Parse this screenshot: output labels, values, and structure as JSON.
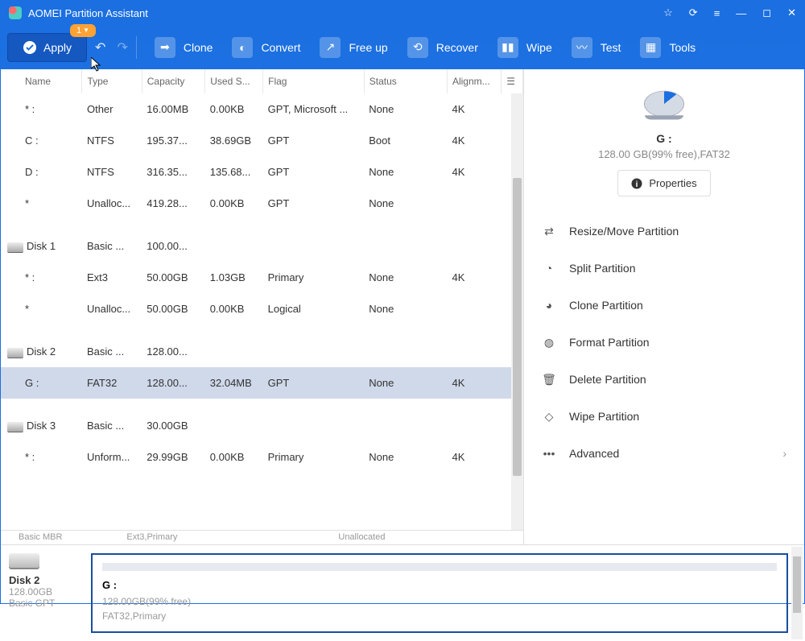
{
  "title": "AOMEI Partition Assistant",
  "apply": {
    "label": "Apply",
    "badge": "1"
  },
  "toolbar": [
    {
      "id": "clone",
      "label": "Clone"
    },
    {
      "id": "convert",
      "label": "Convert"
    },
    {
      "id": "freeup",
      "label": "Free up"
    },
    {
      "id": "recover",
      "label": "Recover"
    },
    {
      "id": "wipe",
      "label": "Wipe"
    },
    {
      "id": "test",
      "label": "Test"
    },
    {
      "id": "tools",
      "label": "Tools"
    }
  ],
  "columns": {
    "name": "Name",
    "type": "Type",
    "capacity": "Capacity",
    "used": "Used S...",
    "flag": "Flag",
    "status": "Status",
    "align": "Alignm..."
  },
  "rows": [
    {
      "disk": false,
      "name": "* :",
      "type": "Other",
      "cap": "16.00MB",
      "used": "0.00KB",
      "flag": "GPT, Microsoft ...",
      "status": "None",
      "align": "4K"
    },
    {
      "disk": false,
      "name": "C :",
      "type": "NTFS",
      "cap": "195.37...",
      "used": "38.69GB",
      "flag": "GPT",
      "status": "Boot",
      "align": "4K"
    },
    {
      "disk": false,
      "name": "D :",
      "type": "NTFS",
      "cap": "316.35...",
      "used": "135.68...",
      "flag": "GPT",
      "status": "None",
      "align": "4K"
    },
    {
      "disk": false,
      "name": "*",
      "type": "Unalloc...",
      "cap": "419.28...",
      "used": "0.00KB",
      "flag": "GPT",
      "status": "None",
      "align": ""
    },
    {
      "disk": true,
      "name": "Disk 1",
      "type": "Basic ...",
      "cap": "100.00...",
      "used": "",
      "flag": "",
      "status": "",
      "align": ""
    },
    {
      "disk": false,
      "name": "* :",
      "type": "Ext3",
      "cap": "50.00GB",
      "used": "1.03GB",
      "flag": "Primary",
      "status": "None",
      "align": "4K"
    },
    {
      "disk": false,
      "name": "*",
      "type": "Unalloc...",
      "cap": "50.00GB",
      "used": "0.00KB",
      "flag": "Logical",
      "status": "None",
      "align": ""
    },
    {
      "disk": true,
      "name": "Disk 2",
      "type": "Basic ...",
      "cap": "128.00...",
      "used": "",
      "flag": "",
      "status": "",
      "align": ""
    },
    {
      "disk": false,
      "selected": true,
      "name": "G :",
      "type": "FAT32",
      "cap": "128.00...",
      "used": "32.04MB",
      "flag": "GPT",
      "status": "None",
      "align": "4K"
    },
    {
      "disk": true,
      "name": "Disk 3",
      "type": "Basic ...",
      "cap": "30.00GB",
      "used": "",
      "flag": "",
      "status": "",
      "align": ""
    },
    {
      "disk": false,
      "name": "* :",
      "type": "Unform...",
      "cap": "29.99GB",
      "used": "0.00KB",
      "flag": "Primary",
      "status": "None",
      "align": "4K"
    }
  ],
  "strip": {
    "a": "Basic MBR",
    "b": "Ext3,Primary",
    "c": "Unallocated"
  },
  "sidebar": {
    "title": "G :",
    "subtitle": "128.00 GB(99% free),FAT32",
    "properties": "Properties",
    "actions": [
      {
        "id": "resize",
        "label": "Resize/Move Partition"
      },
      {
        "id": "split",
        "label": "Split Partition"
      },
      {
        "id": "clone",
        "label": "Clone Partition"
      },
      {
        "id": "format",
        "label": "Format Partition"
      },
      {
        "id": "delete",
        "label": "Delete Partition"
      },
      {
        "id": "wipe",
        "label": "Wipe Partition"
      }
    ],
    "advanced": "Advanced"
  },
  "footer": {
    "disk_label": "Disk 2",
    "disk_size": "128.00GB",
    "disk_type": "Basic GPT",
    "part_name": "G :",
    "part_line1": "128.00GB(99% free)",
    "part_line2": "FAT32,Primary"
  }
}
